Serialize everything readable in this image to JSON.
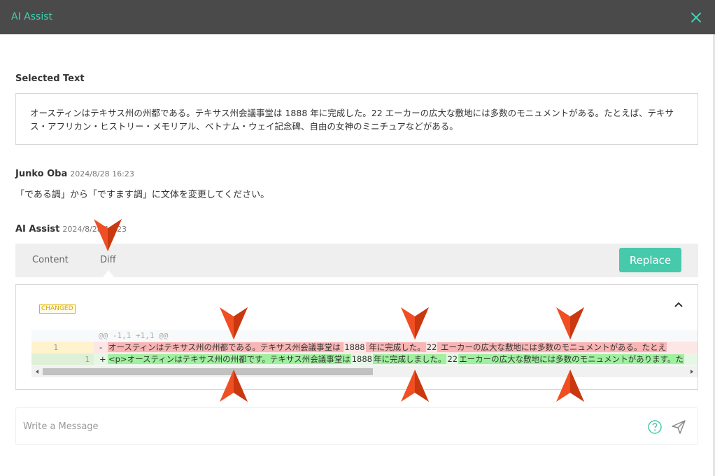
{
  "window": {
    "title": "AI Assist"
  },
  "selected_text": {
    "label": "Selected Text",
    "content": "オースティンはテキサス州の州都である。テキサス州会議事堂は 1888 年に完成した。22 エーカーの広大な敷地には多数のモニュメントがある。たとえば、テキサス・アフリカン・ヒストリー・メモリアル、ベトナム・ウェイ記念碑、自由の女神のミニチュアなどがある。"
  },
  "user_message": {
    "author": "Junko Oba",
    "timestamp": "2024/8/28 16:23",
    "text": "「である調」から「ですます調」に文体を変更してください。"
  },
  "ai_response": {
    "author": "AI Assist",
    "timestamp": "2024/8/28 16:23",
    "tabs": [
      {
        "label": "Content"
      },
      {
        "label": "Diff"
      }
    ],
    "replace_label": "Replace"
  },
  "diff": {
    "badge": "CHANGED",
    "hunk_header": "@@ -1,1 +1,1 @@",
    "deleted": {
      "old_line": "1",
      "new_line": "",
      "marker": "-",
      "segments": [
        {
          "text": "オースティンはテキサス州の州都である。テキサス州会議事堂は ",
          "hl": true
        },
        {
          "text": "1888",
          "hl": false
        },
        {
          "text": " 年に完成した。",
          "hl": true
        },
        {
          "text": "22",
          "hl": false
        },
        {
          "text": " エーカーの広大な敷地には多数のモニュメントがある。たとえ",
          "hl": true
        }
      ]
    },
    "added": {
      "old_line": "",
      "new_line": "1",
      "marker": "+",
      "segments": [
        {
          "text": "<p>オースティンはテキサス州の州都です。テキサス州会議事堂は",
          "hl": true
        },
        {
          "text": "1888",
          "hl": false
        },
        {
          "text": "年に完成しました。",
          "hl": true
        },
        {
          "text": "22",
          "hl": false
        },
        {
          "text": "エーカーの広大な敷地には多数のモニュメントがあります。た",
          "hl": true
        }
      ]
    }
  },
  "composer": {
    "placeholder": "Write a Message"
  },
  "colors": {
    "accent": "#47c9ac",
    "title_text": "#3fd1b3",
    "titlebar_bg": "#4a4a4a",
    "annotation_arrow": "#f04e23"
  },
  "icons": {
    "close": "close-icon",
    "collapse": "chevron-up-icon",
    "help": "help-circle-icon",
    "send": "send-icon"
  }
}
